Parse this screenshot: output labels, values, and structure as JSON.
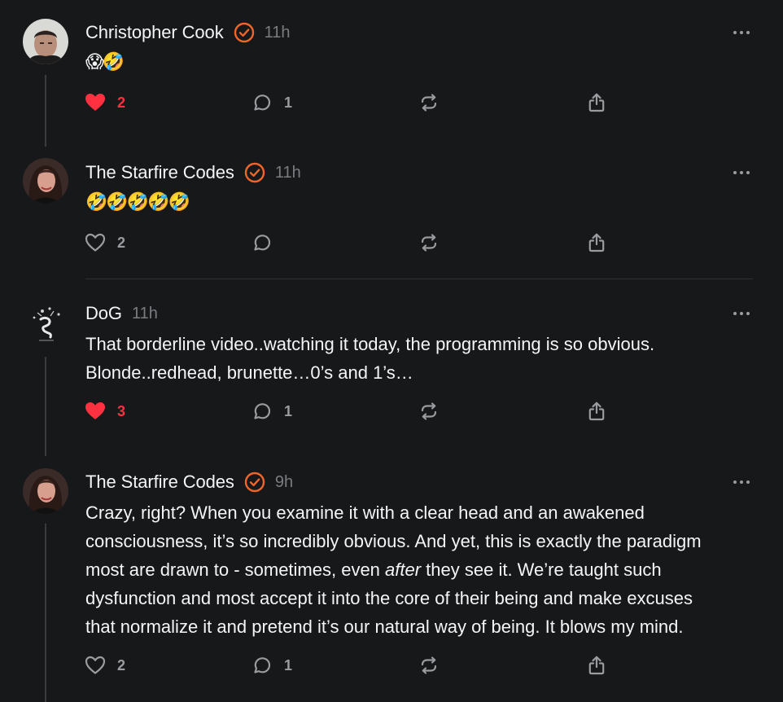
{
  "colors": {
    "background": "#17181a",
    "verified_accent": "#f0652a",
    "like_active": "#ff3040",
    "secondary_text": "#7a7c80"
  },
  "posts": [
    {
      "username": "Christopher Cook",
      "verified": true,
      "time": "11h",
      "body": "😱🤣",
      "liked": true,
      "likes": "2",
      "replies": "1",
      "icons": {
        "like": "heart-filled-icon",
        "reply": "comment-icon",
        "repost": "repost-icon",
        "share": "share-icon"
      }
    },
    {
      "username": "The Starfire Codes",
      "verified": true,
      "time": "11h",
      "body": "🤣🤣🤣🤣🤣",
      "liked": false,
      "likes": "2",
      "replies": "",
      "icons": {
        "like": "heart-outline-icon",
        "reply": "comment-icon",
        "repost": "repost-icon",
        "share": "share-icon"
      }
    },
    {
      "username": "DoG",
      "verified": false,
      "time": "11h",
      "body_lines": [
        "That borderline video..watching it today, the programming is so obvious.",
        "Blonde..redhead, brunette…0’s and 1’s…"
      ],
      "liked": true,
      "likes": "3",
      "replies": "1",
      "icons": {
        "like": "heart-filled-icon",
        "reply": "comment-icon",
        "repost": "repost-icon",
        "share": "share-icon"
      }
    },
    {
      "username": "The Starfire Codes",
      "verified": true,
      "time": "9h",
      "body_parts": {
        "line1": "Crazy, right? When you examine it with a clear head and an awakened",
        "line2": "consciousness, it’s so incredibly obvious. And yet, this is exactly the paradigm",
        "line3_before": "most are drawn to - sometimes, even ",
        "line3_em": "after",
        "line3_after": " they see it. We’re taught such",
        "line4": "dysfunction and most accept it into the core of their being and make excuses",
        "line5": "that normalize it and pretend it’s our natural way of being. It blows my mind."
      },
      "liked": false,
      "likes": "2",
      "replies": "1",
      "icons": {
        "like": "heart-outline-icon",
        "reply": "comment-icon",
        "repost": "repost-icon",
        "share": "share-icon"
      }
    }
  ]
}
